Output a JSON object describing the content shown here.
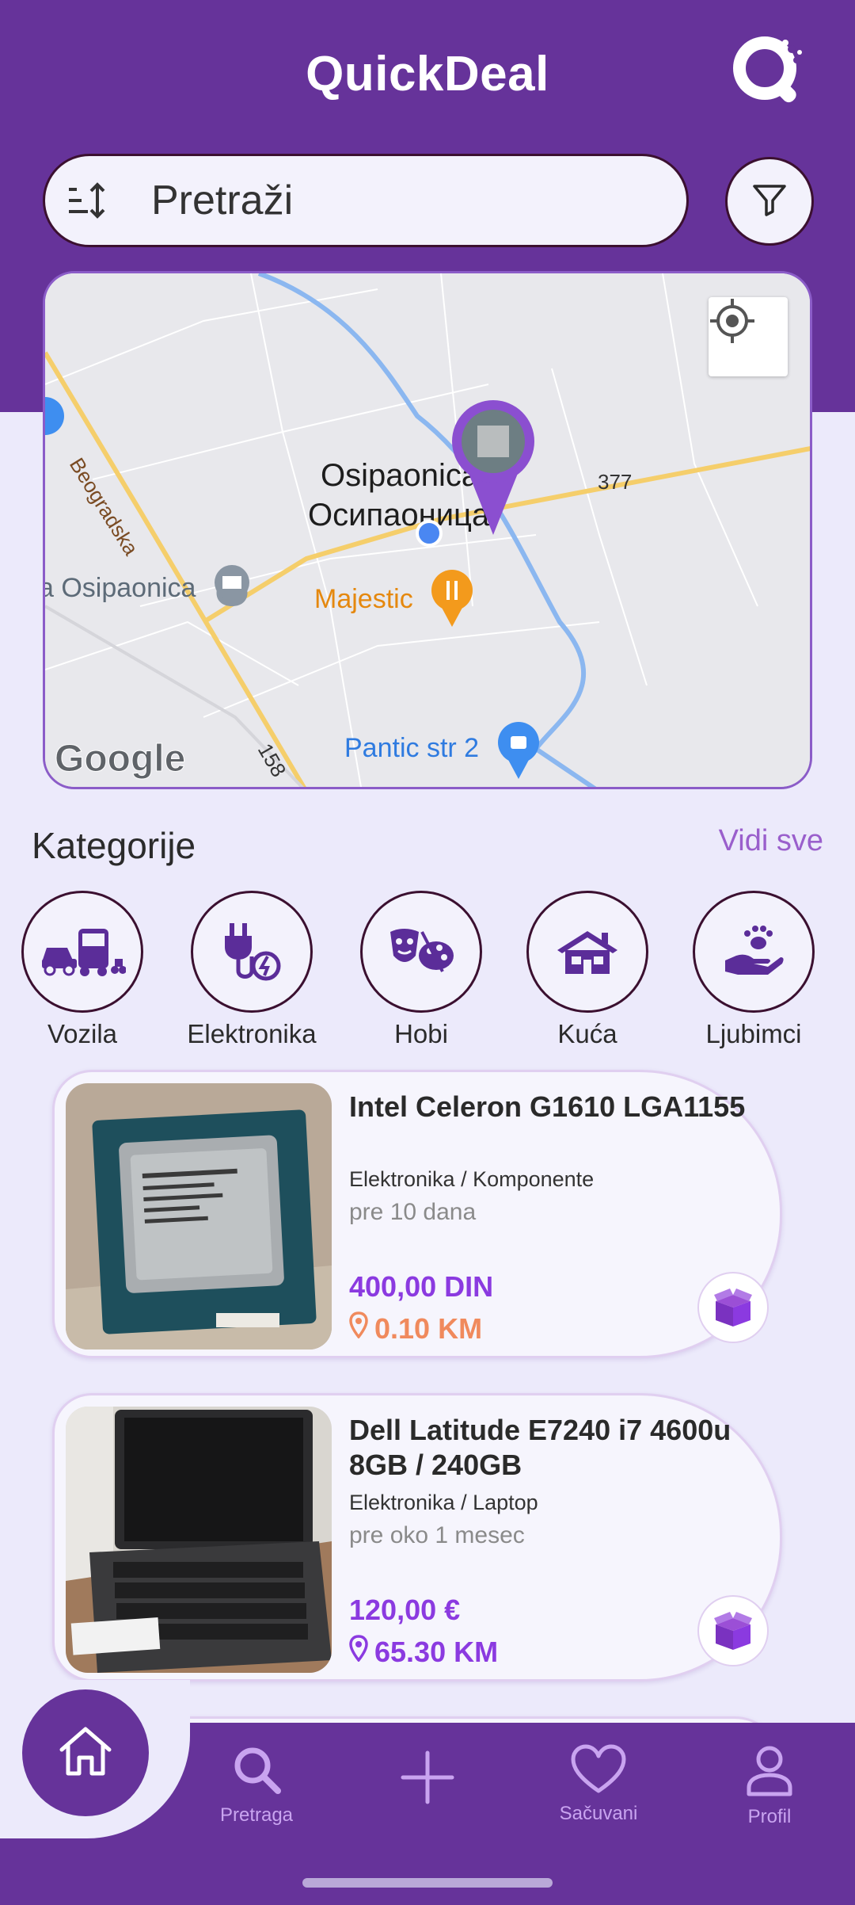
{
  "app": {
    "title": "QuickDeal",
    "logo_icon": "logo-q-icon"
  },
  "search": {
    "placeholder": "Pretraži",
    "sort_icon": "sort-icon",
    "filter_icon": "filter-icon"
  },
  "map": {
    "labels": {
      "town_latin": "Osipaonica",
      "town_cyrillic": "Осипаоница",
      "road_left": "Beogradska",
      "road_num_right": "377",
      "road_num_bottom": "158",
      "poi_post": "a Osipaonica",
      "poi_restaurant": "Majestic",
      "poi_shop": "Pantic str 2",
      "attribution": "Google"
    },
    "locate_icon": "crosshair-icon"
  },
  "categories": {
    "title": "Kategorije",
    "see_all": "Vidi sve",
    "items": [
      {
        "label": "Vozila",
        "icon": "vehicles-icon"
      },
      {
        "label": "Elektronika",
        "icon": "plug-icon"
      },
      {
        "label": "Hobi",
        "icon": "masks-palette-icon"
      },
      {
        "label": "Kuća",
        "icon": "house-icon"
      },
      {
        "label": "Ljubimci",
        "icon": "paw-hand-icon"
      }
    ]
  },
  "listings": [
    {
      "title": "Intel Celeron G1610 LGA1155",
      "category": "Elektronika / Komponente",
      "age": "pre 10 dana",
      "price": "400,00 DIN",
      "distance": "0.10 KM",
      "distance_color": "#F08A5D"
    },
    {
      "title": "Dell Latitude E7240 i7 4600u 8GB / 240GB",
      "category": "Elektronika / Laptop",
      "age": "pre oko 1 mesec",
      "price": "120,00 €",
      "distance": "65.30 KM",
      "distance_color": "#8B3AE0"
    }
  ],
  "nav": {
    "items": [
      {
        "label": "",
        "icon": "home-icon"
      },
      {
        "label": "Pretraga",
        "icon": "search-icon"
      },
      {
        "label": "",
        "icon": "plus-icon"
      },
      {
        "label": "Sačuvani",
        "icon": "heart-icon"
      },
      {
        "label": "Profil",
        "icon": "user-icon"
      }
    ]
  },
  "colors": {
    "brand": "#66339A",
    "accent": "#8B3AE0",
    "background": "#ECEAFB"
  }
}
